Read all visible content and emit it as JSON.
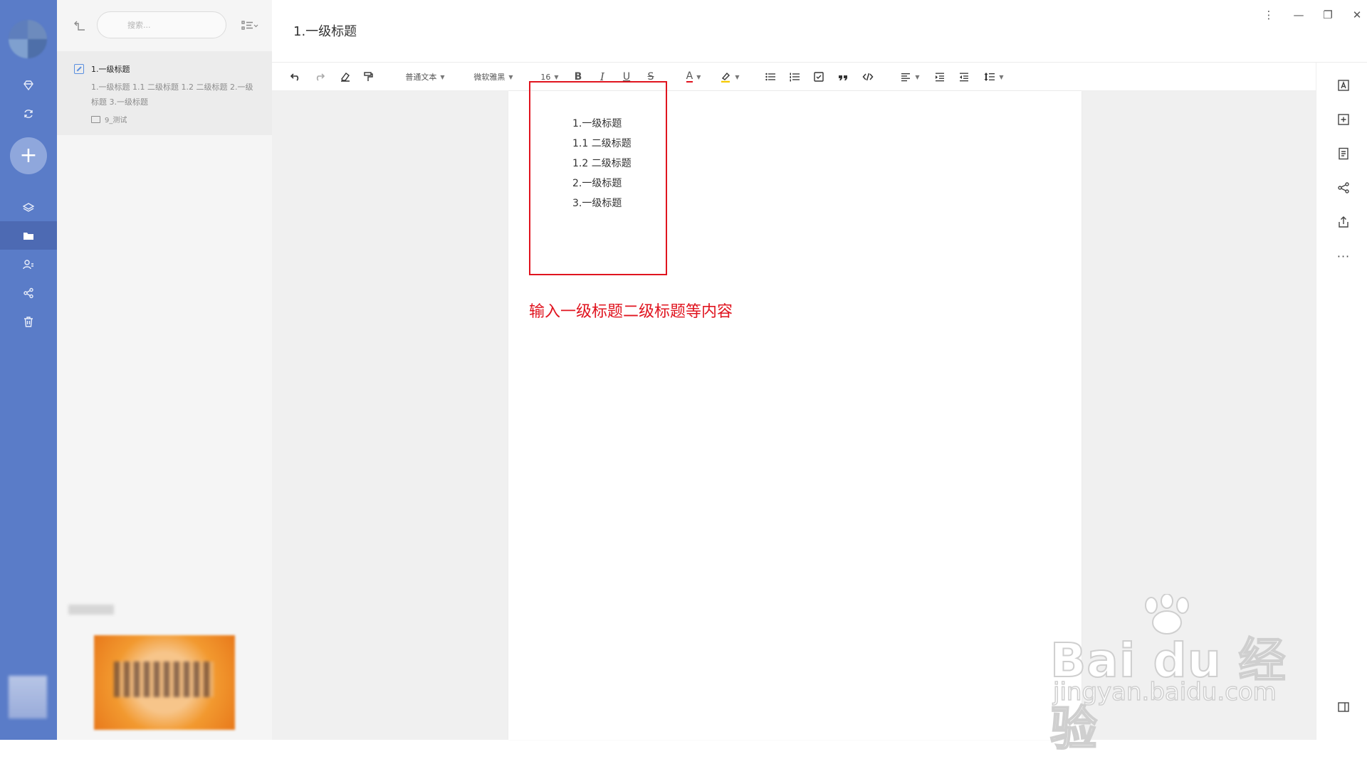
{
  "sidebar": {
    "icons": [
      "diamond-icon",
      "sync-icon",
      "add-icon",
      "layers-icon",
      "folder-icon",
      "contacts-icon",
      "share-icon",
      "trash-icon"
    ]
  },
  "note_list": {
    "search_placeholder": "搜索...",
    "note": {
      "title": "1.一级标题",
      "snippet": "1.一级标题 1.1 二级标题 1.2 二级标题 2.一级标题 3.一级标题",
      "folder": "9_测试"
    }
  },
  "editor": {
    "doc_title": "1.一级标题",
    "toolbar": {
      "paragraph_style": "普通文本",
      "font_family": "微软雅黑",
      "font_size": "16",
      "bold": "B",
      "italic": "I",
      "underline": "U",
      "strike": "S",
      "font_color": "A"
    },
    "content_lines": [
      "1.一级标题",
      "1.1 二级标题",
      "1.2 二级标题",
      "2.一级标题",
      "3.一级标题"
    ],
    "annotation": "输入一级标题二级标题等内容"
  },
  "window": {
    "more": "⋮",
    "minimize": "—",
    "restore": "❐",
    "close": "✕"
  },
  "watermark": {
    "brand": "Bai du 经验",
    "url": "jingyan.baidu.com"
  },
  "colors": {
    "rail": "#5a7cc8",
    "annotation_red": "#e0141f"
  }
}
